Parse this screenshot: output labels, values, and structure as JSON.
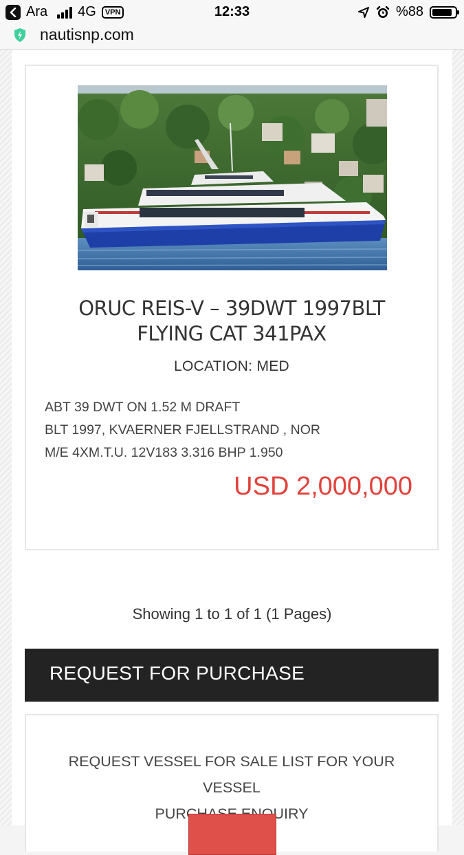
{
  "status_bar": {
    "carrier": "Ara",
    "network": "4G",
    "vpn": "VPN",
    "time": "12:33",
    "battery": "%88",
    "battery_level": 0.88
  },
  "browser": {
    "url": "nautisnp.com"
  },
  "listing": {
    "title_line1": "ORUC REIS-V – 39DWT 1997BLT",
    "title_line2": "FLYING CAT 341PAX",
    "location": "LOCATION: MED",
    "specs": [
      "ABT 39 DWT ON 1.52 M DRAFT",
      "BLT 1997, KVAERNER FJELLSTRAND , NOR",
      "M/E 4XM.T.U. 12V183 3.316 BHP 1.950"
    ],
    "price": "USD 2,000,000"
  },
  "pagination": {
    "text": "Showing 1 to 1 of 1 (1 Pages)"
  },
  "request": {
    "header": "REQUEST FOR PURCHASE",
    "text_line1": "REQUEST VESSEL FOR SALE LIST FOR YOUR VESSEL",
    "text_line2": "PURCHASE ENQUIRY"
  },
  "colors": {
    "price": "#e1413b",
    "header_bg": "#232323",
    "button": "#e0504a"
  }
}
